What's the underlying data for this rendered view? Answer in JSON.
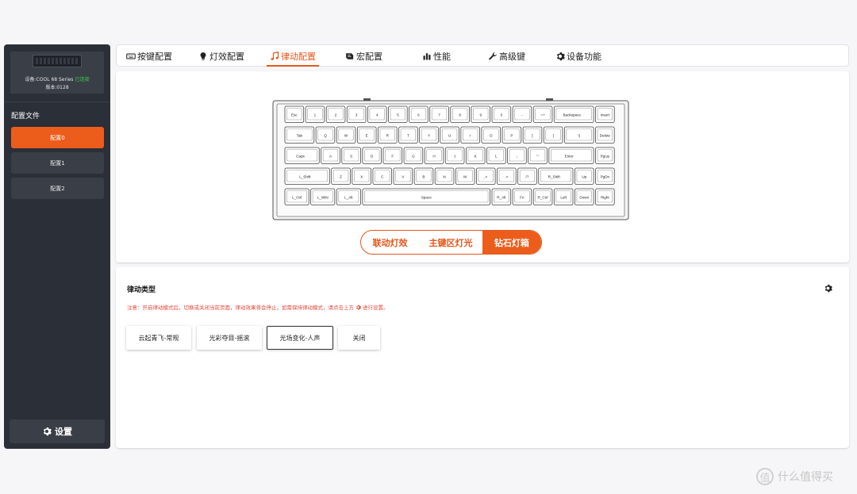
{
  "sidebar": {
    "device_label": "设备:COOL 68 Series",
    "device_status": "已连接",
    "version_label": "版本:0128",
    "profiles_title": "配置文件",
    "profiles": [
      {
        "label": "配置0",
        "active": true
      },
      {
        "label": "配置1",
        "active": false
      },
      {
        "label": "配置2",
        "active": false
      }
    ],
    "settings_label": "设置",
    "settings_icon": "gear-icon"
  },
  "tabs": [
    {
      "label": "按键配置",
      "icon": "keyboard-icon",
      "active": false
    },
    {
      "label": "灯效配置",
      "icon": "bulb-icon",
      "active": false
    },
    {
      "label": "律动配置",
      "icon": "music-icon",
      "active": true
    },
    {
      "label": "宏配置",
      "icon": "macro-icon",
      "active": false
    },
    {
      "label": "性能",
      "icon": "bar-chart-icon",
      "active": false
    },
    {
      "label": "高级键",
      "icon": "wrench-icon",
      "active": false
    },
    {
      "label": "设备功能",
      "icon": "gear-icon",
      "active": false
    }
  ],
  "keyboard": {
    "rows": [
      [
        "Esc",
        "1",
        "2",
        "3",
        "4",
        "5",
        "6",
        "7",
        "8",
        "9",
        "0",
        "-",
        "=+",
        "Backspace",
        "Insert"
      ],
      [
        "Tab",
        "Q",
        "W",
        "E",
        "R",
        "T",
        "Y",
        "U",
        "I",
        "O",
        "P",
        "[",
        "]",
        "\\|",
        "Delete"
      ],
      [
        "Caps",
        "A",
        "S",
        "D",
        "F",
        "G",
        "H",
        "J",
        "K",
        "L",
        ";",
        "'\"",
        "Enter",
        "PgUp"
      ],
      [
        "L_Shift",
        "Z",
        "X",
        "C",
        "V",
        "B",
        "N",
        "M",
        ",<",
        ".>",
        "/?",
        "R_Shift",
        "Up",
        "PgDn"
      ],
      [
        "L_Ctrl",
        "L_WIN",
        "L_Alt",
        "Space",
        "R_Alt",
        "Fn",
        "R_Ctrl",
        "Left",
        "Down",
        "Right"
      ]
    ]
  },
  "light_zones": [
    {
      "label": "联动灯效",
      "active": false
    },
    {
      "label": "主键区灯光",
      "active": false
    },
    {
      "label": "钻石灯箱",
      "active": true
    }
  ],
  "rhythm": {
    "title": "律动类型",
    "note_before": "注意：开启律动模式后，切换或关闭当前页面，律动效果将会停止，如需保持律动模式，请点击上方",
    "note_after": "进行设置。",
    "options": [
      {
        "label": "云起青飞-常规",
        "active": false
      },
      {
        "label": "光彩夺目-摇滚",
        "active": false
      },
      {
        "label": "光场变化-人声",
        "active": true
      },
      {
        "label": "关闭",
        "active": false
      }
    ]
  },
  "watermark": "什么值得买",
  "colors": {
    "accent": "#ec5d1c",
    "sidebar": "#2b2f38",
    "status": "#38d34a",
    "warning": "#e04a3a"
  }
}
